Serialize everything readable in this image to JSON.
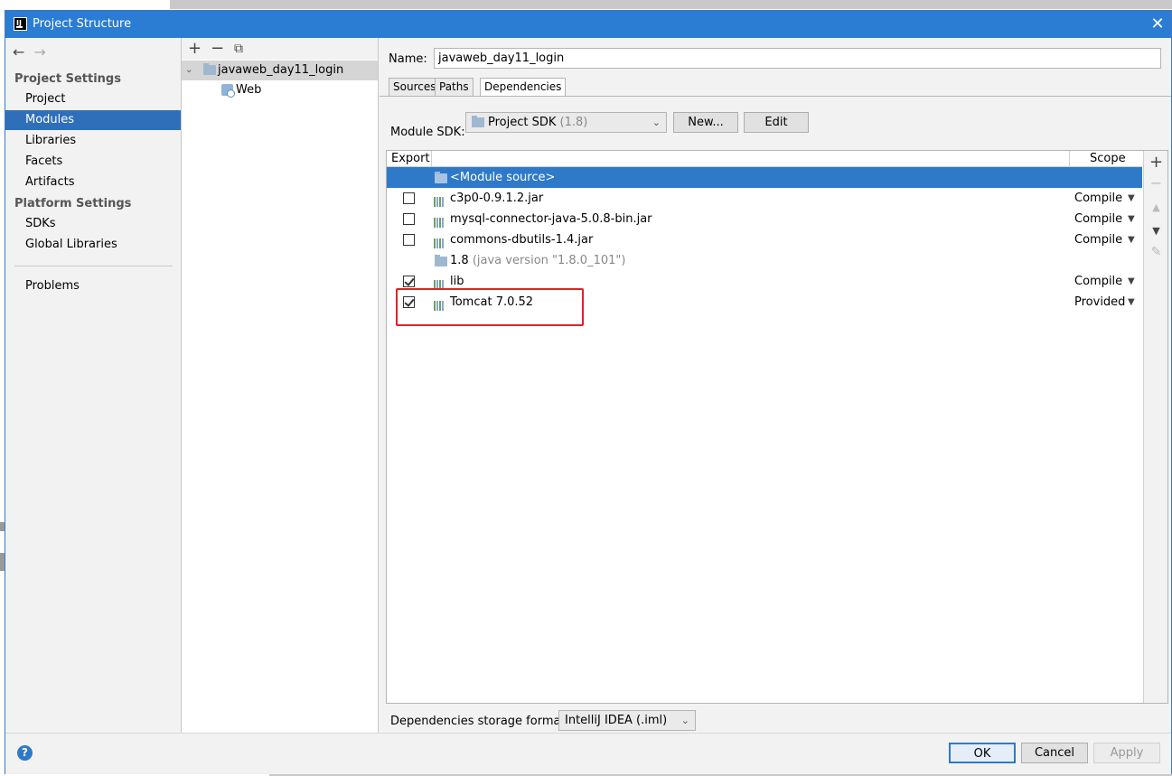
{
  "window": {
    "title": "Project Structure"
  },
  "nav": {
    "project_settings_header": "Project Settings",
    "platform_settings_header": "Platform Settings",
    "items": [
      "Project",
      "Modules",
      "Libraries",
      "Facets",
      "Artifacts"
    ],
    "platform_items": [
      "SDKs",
      "Global Libraries"
    ],
    "problems": "Problems",
    "selected": "Modules"
  },
  "tree": {
    "module": "javaweb_day11_login",
    "child": "Web"
  },
  "content": {
    "name_label": "Name:",
    "name_value": "javaweb_day11_login",
    "tabs": [
      "Sources",
      "Paths",
      "Dependencies"
    ],
    "active_tab": "Dependencies",
    "sdk_label": "Module SDK:",
    "sdk_value": "Project SDK",
    "sdk_version": "(1.8)",
    "new_button": "New...",
    "edit_button": "Edit",
    "columns": {
      "export": "Export",
      "scope": "Scope"
    },
    "dependencies": [
      {
        "name": "<Module source>",
        "extra": "",
        "checkbox": false,
        "checked": false,
        "scope": ""
      },
      {
        "name": "c3p0-0.9.1.2.jar",
        "extra": "",
        "checkbox": true,
        "checked": false,
        "scope": "Compile"
      },
      {
        "name": "mysql-connector-java-5.0.8-bin.jar",
        "extra": "",
        "checkbox": true,
        "checked": false,
        "scope": "Compile"
      },
      {
        "name": "commons-dbutils-1.4.jar",
        "extra": "",
        "checkbox": true,
        "checked": false,
        "scope": "Compile"
      },
      {
        "name": "1.8",
        "extra": "(java version \"1.8.0_101\")",
        "checkbox": false,
        "checked": false,
        "scope": ""
      },
      {
        "name": "lib",
        "extra": "",
        "checkbox": true,
        "checked": true,
        "scope": "Compile"
      },
      {
        "name": "Tomcat 7.0.52",
        "extra": "",
        "checkbox": true,
        "checked": true,
        "scope": "Provided"
      }
    ],
    "storage_label": "Dependencies storage format:",
    "storage_value": "IntelliJ IDEA (.iml)"
  },
  "footer": {
    "ok": "OK",
    "cancel": "Cancel",
    "apply": "Apply"
  },
  "colors": {
    "titlebar": "#2b7cd3",
    "selection": "#2f6fb9",
    "highlight": "#e0202a"
  }
}
